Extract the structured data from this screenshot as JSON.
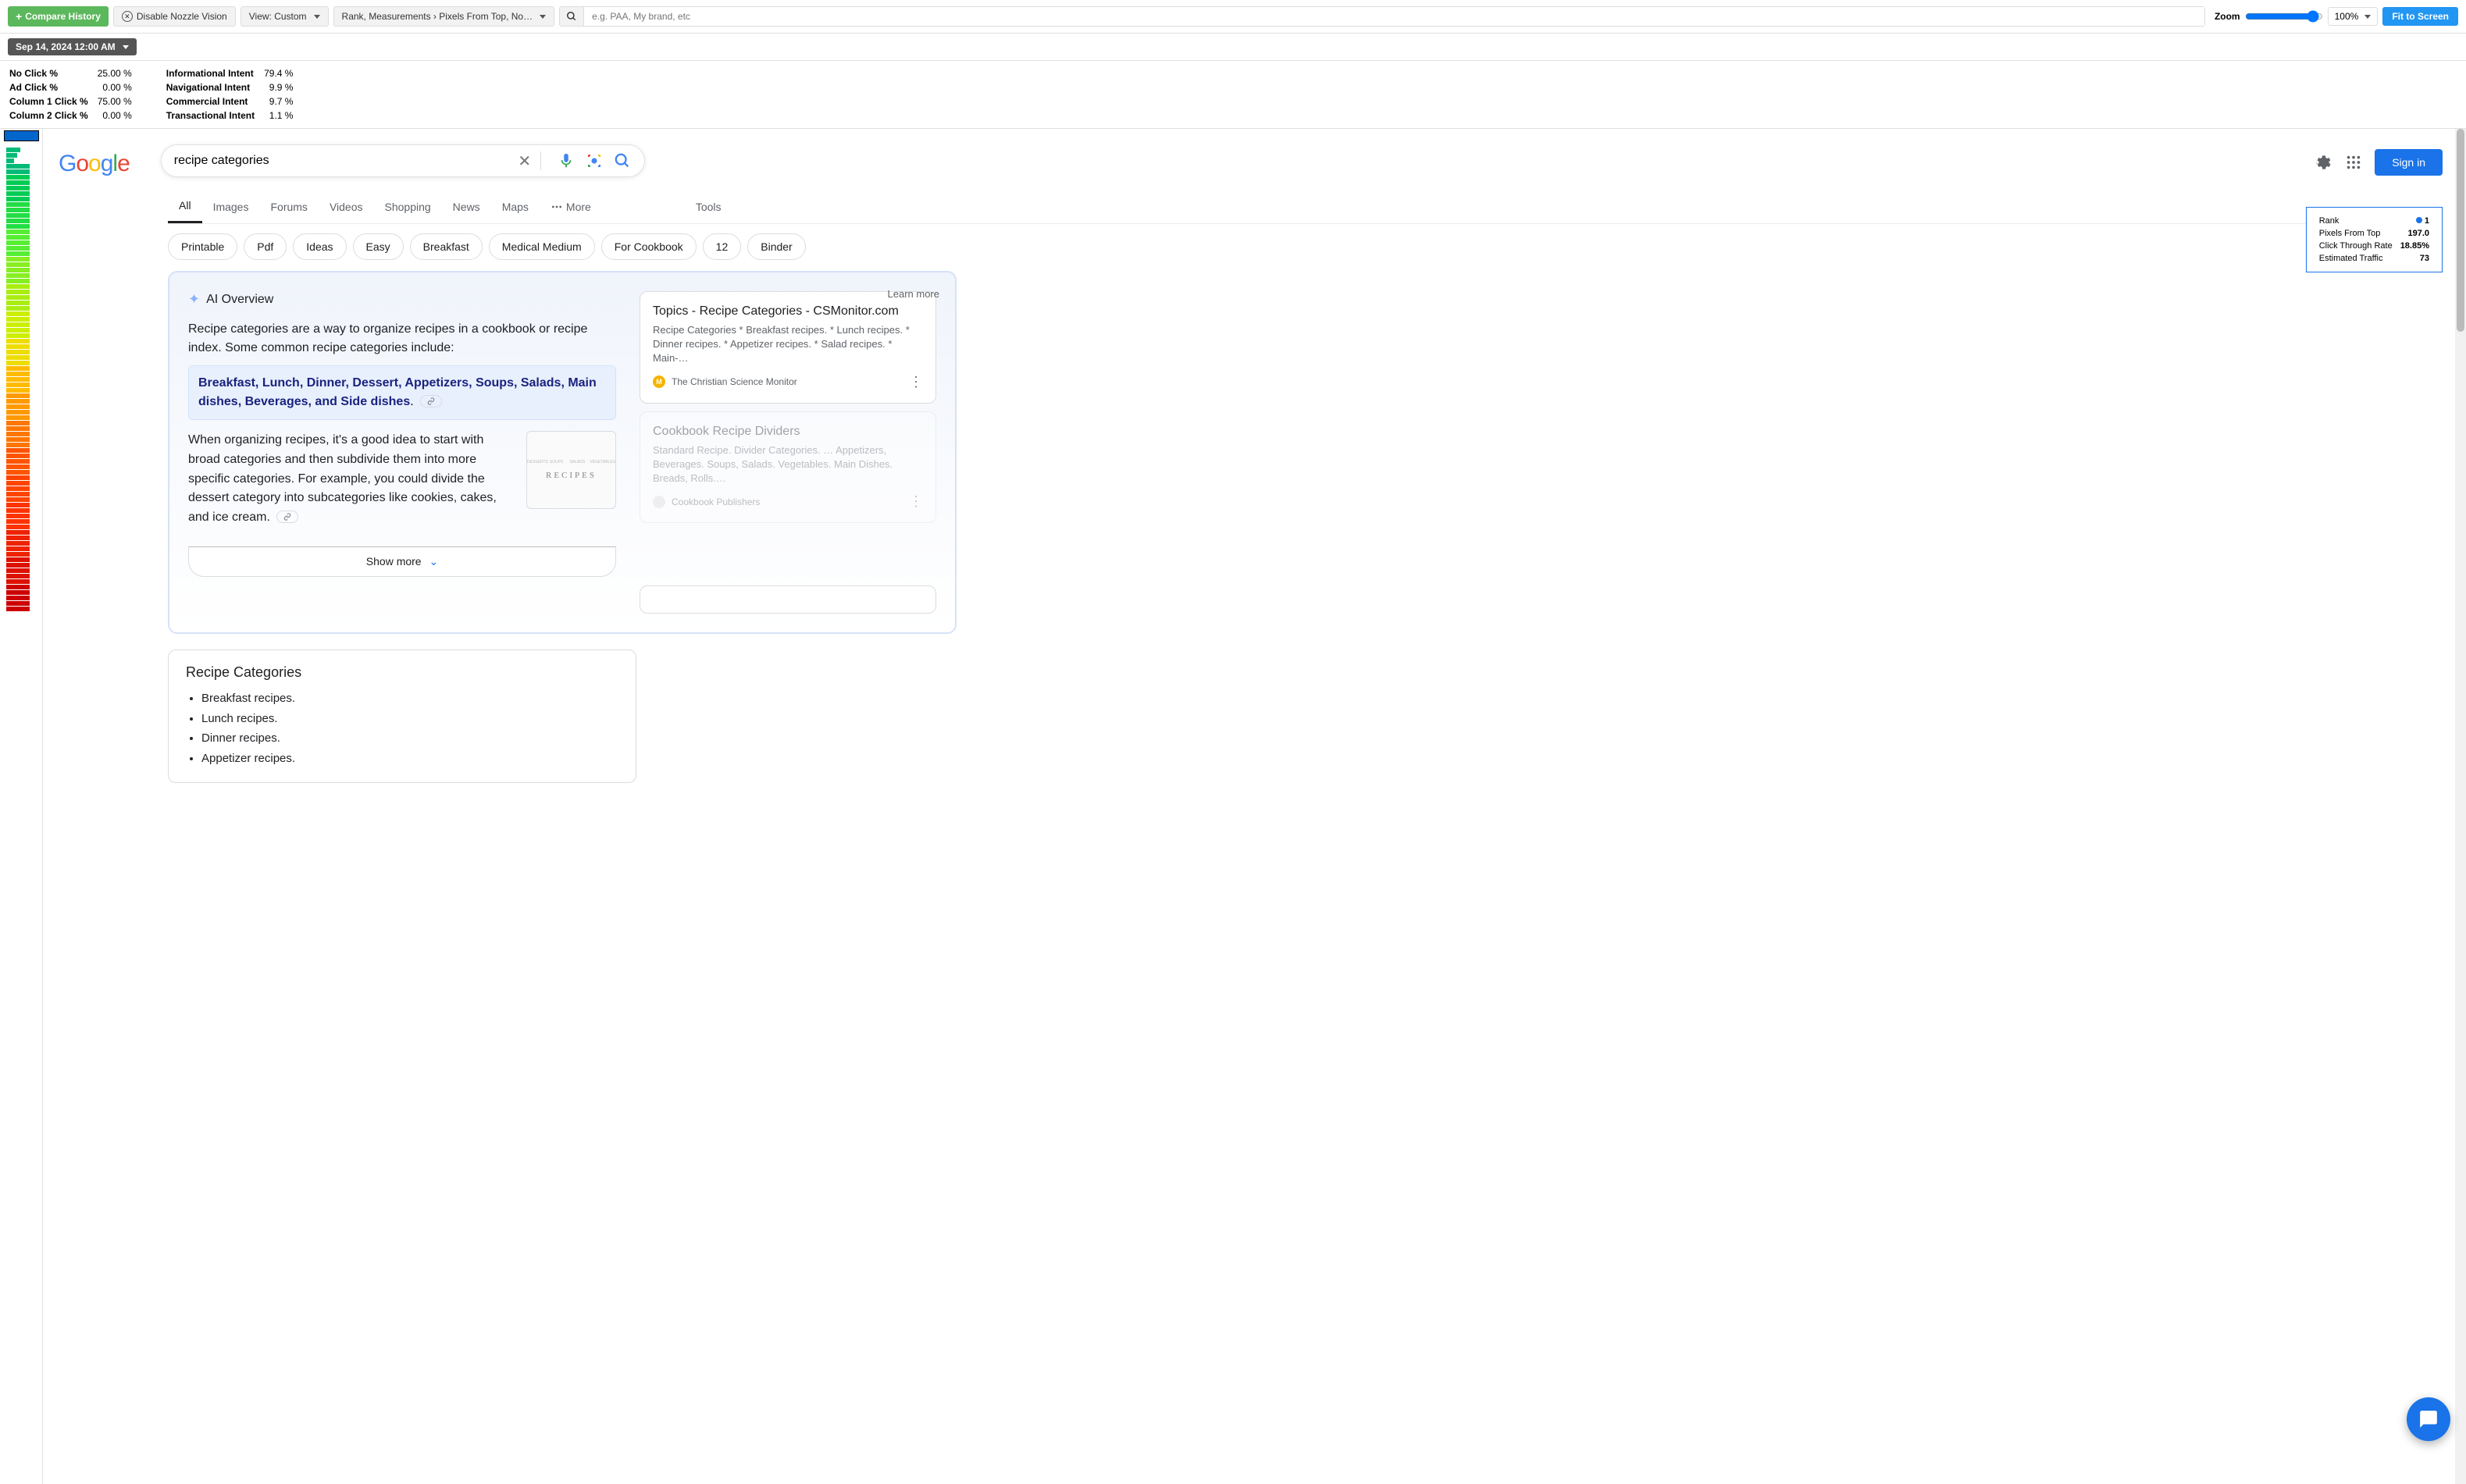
{
  "toolbar": {
    "compare_history": "Compare History",
    "disable_nozzle": "Disable Nozzle Vision",
    "view_label": "View: Custom",
    "rank_label": "Rank, Measurements › Pixels From Top, No…",
    "search_placeholder": "e.g. PAA, My brand, etc",
    "zoom_label": "Zoom",
    "zoom_value": "100%",
    "fit_screen": "Fit to Screen"
  },
  "datebar": {
    "date": "Sep 14, 2024 12:00 AM"
  },
  "stats_left": [
    {
      "label": "No Click %",
      "value": "25.00 %"
    },
    {
      "label": "Ad Click %",
      "value": "0.00 %"
    },
    {
      "label": "Column 1 Click %",
      "value": "75.00 %"
    },
    {
      "label": "Column 2 Click %",
      "value": "0.00 %"
    }
  ],
  "stats_right": [
    {
      "label": "Informational Intent",
      "value": "79.4 %"
    },
    {
      "label": "Navigational Intent",
      "value": "9.9 %"
    },
    {
      "label": "Commercial Intent",
      "value": "9.7 %"
    },
    {
      "label": "Transactional Intent",
      "value": "1.1 %"
    }
  ],
  "google": {
    "logo_chars": [
      "G",
      "o",
      "o",
      "g",
      "l",
      "e"
    ],
    "query": "recipe categories",
    "sign_in": "Sign in",
    "tabs": [
      "All",
      "Images",
      "Forums",
      "Videos",
      "Shopping",
      "News",
      "Maps"
    ],
    "more": "More",
    "tools": "Tools",
    "chips": [
      "Printable",
      "Pdf",
      "Ideas",
      "Easy",
      "Breakfast",
      "Medical Medium",
      "For Cookbook",
      "12",
      "Binder"
    ]
  },
  "rank_card": {
    "rows": [
      {
        "k": "Rank",
        "v": "1",
        "dot": true
      },
      {
        "k": "Pixels From Top",
        "v": "197.0"
      },
      {
        "k": "Click Through Rate",
        "v": "18.85%"
      },
      {
        "k": "Estimated Traffic",
        "v": "73"
      }
    ]
  },
  "ai": {
    "title": "AI Overview",
    "learn": "Learn more",
    "text1": "Recipe categories are a way to organize recipes in a cookbook or recipe index. Some common recipe categories include:",
    "highlight_bold": "Breakfast, Lunch, Dinner, Dessert, Appetizers, Soups, Salads, Main dishes, Beverages, and Side dishes",
    "highlight_tail": ".",
    "body": "When organizing recipes, it's a good idea to start with broad categories and then subdivide them into more specific categories. For example, you could divide the dessert category into subcategories like cookies, cakes, and ice cream.",
    "thumb_caption": "RECIPES",
    "show_more": "Show more"
  },
  "refs": [
    {
      "title": "Topics - Recipe Categories - CSMonitor.com",
      "snippet": "Recipe Categories * Breakfast recipes. * Lunch recipes. * Dinner recipes. * Appetizer recipes. * Salad recipes. * Main-…",
      "source": "The Christian Science Monitor",
      "favicon_letter": "M",
      "favicon_color": "#f4b400"
    },
    {
      "title": "Cookbook Recipe Dividers",
      "snippet": "Standard Recipe. Divider Categories. … Appetizers, Beverages. Soups, Salads. Vegetables. Main Dishes. Breads, Rolls.…",
      "source": "Cookbook Publishers",
      "favicon_letter": "",
      "favicon_color": "#ddd",
      "faded": true
    }
  ],
  "result": {
    "title": "Recipe Categories",
    "items": [
      "Breakfast recipes.",
      "Lunch recipes.",
      "Dinner recipes.",
      "Appetizer recipes."
    ]
  }
}
